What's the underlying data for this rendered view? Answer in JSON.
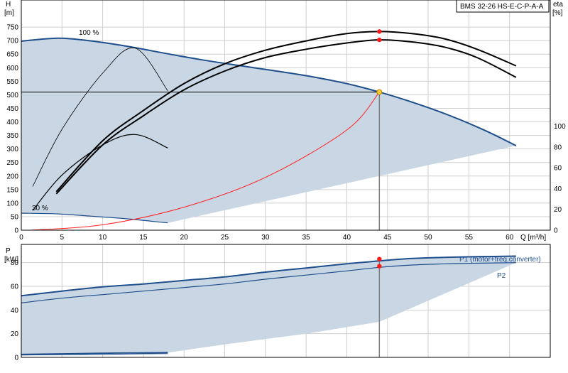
{
  "chart_data": [
    {
      "type": "line",
      "title": "BMS 32-26 HS-E-C-P-A-A",
      "ylabel": "H",
      "yunit": "[m]",
      "ylabel_right": "eta",
      "yunit_right": "[%]",
      "xlabel": "Q [m³/h]",
      "xlim": [
        0,
        65
      ],
      "ylim": [
        0,
        800
      ],
      "ylim_right": [
        0,
        200
      ],
      "xticks": [
        0,
        5,
        10,
        15,
        20,
        25,
        30,
        35,
        40,
        45,
        50,
        55,
        60
      ],
      "yticks": [
        0,
        50,
        100,
        150,
        200,
        250,
        300,
        350,
        400,
        450,
        500,
        550,
        600,
        650,
        700,
        750
      ],
      "yticks_right": [
        0,
        20,
        40,
        60,
        80,
        100
      ],
      "grid": true,
      "annotations": [
        "100 %",
        "30 %"
      ],
      "colors": {
        "head": "#1f4e8c",
        "area": "#c9d6e3",
        "system": "#ff2020",
        "eta": "#000000",
        "op_point": "#ffcc33"
      },
      "operating_point": {
        "x": 44,
        "y": 510
      },
      "series": [
        {
          "x": [
            0,
            4.5,
            8.5,
            13,
            17.5,
            22,
            26.5,
            31,
            35.5,
            40,
            44,
            48,
            52.5,
            57,
            60.8
          ],
          "values": [
            698,
            709,
            699,
            679,
            654,
            630,
            609,
            589,
            568,
            541,
            510,
            473,
            425,
            368,
            312
          ]
        },
        {
          "x": [
            0,
            4.5,
            8.5,
            13,
            18
          ],
          "values": [
            63,
            60,
            52,
            42,
            27
          ]
        },
        {
          "x": [
            1,
            10,
            20,
            30,
            40,
            44
          ],
          "values": [
            0,
            20,
            85,
            195,
            370,
            510
          ]
        },
        {
          "x": [
            4.3,
            10,
            15,
            20,
            25,
            30,
            35,
            40,
            44,
            48,
            52,
            56,
            60.8
          ],
          "values": [
            37,
            86,
            115,
            141,
            160,
            173,
            182,
            189,
            191,
            189,
            184,
            174,
            158
          ]
        },
        {
          "x": [
            4.3,
            10,
            15,
            20,
            25,
            30,
            35,
            40,
            44,
            48,
            52,
            56,
            60.8
          ],
          "values": [
            35,
            82,
            110,
            135,
            153,
            166,
            174,
            180,
            183,
            181,
            176,
            166,
            147
          ]
        },
        {
          "x": [
            1.4,
            5,
            10,
            14,
            18
          ],
          "values": [
            19,
            53,
            82,
            92,
            79
          ]
        },
        {
          "x": [
            1.4,
            5,
            10,
            14,
            18
          ],
          "values": [
            42,
            97,
            151,
            175,
            134
          ]
        }
      ]
    },
    {
      "type": "line",
      "ylabel": "P",
      "yunit": "[kW]",
      "xlim": [
        0,
        65
      ],
      "ylim": [
        0,
        90
      ],
      "yticks": [
        0,
        20,
        40,
        60,
        80
      ],
      "grid": true,
      "operating_points": [
        {
          "x": 44,
          "y": 83
        },
        {
          "x": 44,
          "y": 77
        }
      ],
      "series": [
        {
          "name": "P1 (motor+freq.converter)",
          "x": [
            0,
            5,
            10,
            15,
            20,
            25,
            30,
            35,
            40,
            44,
            48,
            52,
            56,
            60.8
          ],
          "values": [
            52,
            56,
            59.5,
            62,
            65,
            68,
            72,
            75.5,
            79,
            81.5,
            83.5,
            84.5,
            85,
            85.5
          ]
        },
        {
          "name": "P2",
          "x": [
            0,
            5,
            10,
            15,
            20,
            25,
            30,
            35,
            40,
            44,
            48,
            52,
            56,
            60.8
          ],
          "values": [
            46,
            50,
            53,
            56,
            59,
            62,
            66,
            69.5,
            73,
            76,
            78,
            79,
            79.5,
            80
          ]
        },
        {
          "x": [
            0,
            5,
            10,
            15,
            18
          ],
          "values": [
            2.5,
            3,
            3.5,
            3.8,
            4
          ]
        },
        {
          "x": [
            0,
            5,
            10,
            15,
            18
          ],
          "values": [
            2,
            2.3,
            2.6,
            3,
            3.2
          ]
        }
      ]
    }
  ]
}
